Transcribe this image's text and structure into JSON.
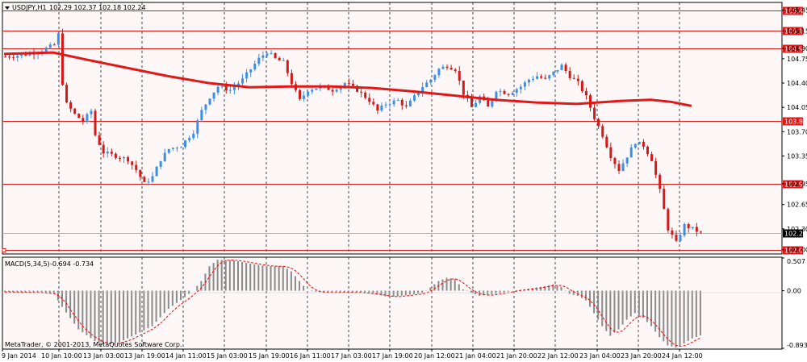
{
  "window": {
    "symbol_title": "USDJPY,H1",
    "ohlc_readout": "102.29 102.37 102.18 102.24",
    "dropdown_icon": "triangle-down-icon"
  },
  "indicator": {
    "title": "MACD(5,34,5)",
    "readout": "-0.694 -0.734"
  },
  "footer": {
    "copyright": "MetaTrader, © 2001-2013, MetaQuotes Software Corp."
  },
  "colors": {
    "background": "#fdf7f7",
    "bull_candle": "#3c8ee6",
    "bear_candle": "#d11a1a",
    "moving_average": "#e01818",
    "horizontal_line": "#e01818",
    "grid": "#000000",
    "macd_histogram": "#8a8a8a",
    "macd_signal": "#ff0000",
    "bid_line": "#b0b0b0"
  },
  "chart_data": [
    {
      "type": "candlestick",
      "title": "USDJPY,H1",
      "ylim": [
        101.95,
        105.55
      ],
      "y_ticks": [
        105.45,
        105.15,
        104.9,
        104.75,
        104.4,
        104.05,
        103.7,
        103.35,
        102.95,
        102.65,
        102.3,
        102.0
      ],
      "y_tick_labels": [
        "105.45",
        "105.15",
        "104.90",
        "104.75",
        "104.40",
        "104.05",
        "103.70",
        "103.35",
        "102.95",
        "102.65",
        "102.30",
        "102.00"
      ],
      "highlighted_levels": [
        "105.45",
        "105.15",
        "104.90",
        "103.85",
        "102.95",
        "102.00"
      ],
      "current_price": "102.24",
      "x_tick_labels": [
        "9 Jan 2014",
        "10 Jan 10:00",
        "13 Jan 03:00",
        "13 Jan 19:00",
        "14 Jan 11:00",
        "15 Jan 03:00",
        "15 Jan 19:00",
        "16 Jan 11:00",
        "17 Jan 03:00",
        "17 Jan 19:00",
        "20 Jan 12:00",
        "21 Jan 04:00",
        "21 Jan 20:00",
        "22 Jan 12:00",
        "23 Jan 04:00",
        "23 Jan 20:00",
        "24 Jan 12:00"
      ],
      "grid": true,
      "trend_path": [
        [
          0,
          104.78
        ],
        [
          4,
          104.8
        ],
        [
          8,
          104.85
        ],
        [
          10,
          104.9
        ],
        [
          12,
          104.95
        ],
        [
          13,
          105.1
        ],
        [
          14,
          104.4
        ],
        [
          15,
          104.1
        ],
        [
          17,
          103.95
        ],
        [
          19,
          103.85
        ],
        [
          21,
          104.0
        ],
        [
          22,
          103.65
        ],
        [
          24,
          103.4
        ],
        [
          27,
          103.35
        ],
        [
          30,
          103.3
        ],
        [
          32,
          103.15
        ],
        [
          34,
          102.95
        ],
        [
          36,
          103.05
        ],
        [
          38,
          103.3
        ],
        [
          40,
          103.45
        ],
        [
          43,
          103.5
        ],
        [
          46,
          103.7
        ],
        [
          48,
          104.0
        ],
        [
          50,
          104.2
        ],
        [
          52,
          104.35
        ],
        [
          55,
          104.3
        ],
        [
          58,
          104.45
        ],
        [
          60,
          104.6
        ],
        [
          62,
          104.75
        ],
        [
          64,
          104.85
        ],
        [
          66,
          104.75
        ],
        [
          68,
          104.7
        ],
        [
          70,
          104.4
        ],
        [
          72,
          104.15
        ],
        [
          74,
          104.3
        ],
        [
          77,
          104.35
        ],
        [
          80,
          104.3
        ],
        [
          83,
          104.4
        ],
        [
          86,
          104.3
        ],
        [
          89,
          104.15
        ],
        [
          91,
          104.0
        ],
        [
          93,
          104.1
        ],
        [
          96,
          104.15
        ],
        [
          98,
          104.05
        ],
        [
          100,
          104.2
        ],
        [
          102,
          104.35
        ],
        [
          104,
          104.45
        ],
        [
          106,
          104.6
        ],
        [
          108,
          104.65
        ],
        [
          110,
          104.6
        ],
        [
          112,
          104.25
        ],
        [
          114,
          104.05
        ],
        [
          116,
          104.2
        ],
        [
          118,
          104.05
        ],
        [
          120,
          104.3
        ],
        [
          123,
          104.25
        ],
        [
          126,
          104.35
        ],
        [
          128,
          104.45
        ],
        [
          130,
          104.5
        ],
        [
          132,
          104.45
        ],
        [
          134,
          104.55
        ],
        [
          136,
          104.65
        ],
        [
          138,
          104.5
        ],
        [
          140,
          104.4
        ],
        [
          142,
          104.2
        ],
        [
          144,
          103.9
        ],
        [
          146,
          103.65
        ],
        [
          148,
          103.35
        ],
        [
          150,
          103.15
        ],
        [
          152,
          103.35
        ],
        [
          154,
          103.55
        ],
        [
          156,
          103.5
        ],
        [
          158,
          103.3
        ],
        [
          160,
          102.85
        ],
        [
          162,
          102.3
        ],
        [
          164,
          102.1
        ],
        [
          166,
          102.35
        ],
        [
          168,
          102.3
        ],
        [
          170,
          102.24
        ]
      ],
      "moving_average": [
        [
          0,
          104.82
        ],
        [
          12,
          104.84
        ],
        [
          20,
          104.74
        ],
        [
          30,
          104.62
        ],
        [
          40,
          104.5
        ],
        [
          50,
          104.4
        ],
        [
          60,
          104.34
        ],
        [
          70,
          104.35
        ],
        [
          80,
          104.35
        ],
        [
          90,
          104.33
        ],
        [
          100,
          104.28
        ],
        [
          110,
          104.22
        ],
        [
          120,
          104.16
        ],
        [
          130,
          104.12
        ],
        [
          140,
          104.1
        ],
        [
          150,
          104.14
        ],
        [
          158,
          104.16
        ],
        [
          163,
          104.13
        ],
        [
          168,
          104.07
        ]
      ]
    },
    {
      "type": "histogram",
      "title": "MACD(5,34,5)",
      "ylim": [
        -0.893,
        0.507
      ],
      "y_ticks": [
        0.507,
        0.0,
        -0.893
      ],
      "y_tick_labels": [
        "0.507",
        "0.00",
        "-0.893"
      ],
      "macd_path": [
        [
          0,
          -0.02
        ],
        [
          8,
          -0.03
        ],
        [
          12,
          -0.05
        ],
        [
          14,
          -0.25
        ],
        [
          18,
          -0.6
        ],
        [
          22,
          -0.78
        ],
        [
          24,
          -0.83
        ],
        [
          28,
          -0.8
        ],
        [
          32,
          -0.68
        ],
        [
          36,
          -0.55
        ],
        [
          40,
          -0.28
        ],
        [
          44,
          -0.1
        ],
        [
          46,
          0.0
        ],
        [
          48,
          0.15
        ],
        [
          50,
          0.38
        ],
        [
          52,
          0.48
        ],
        [
          56,
          0.47
        ],
        [
          60,
          0.42
        ],
        [
          64,
          0.38
        ],
        [
          68,
          0.38
        ],
        [
          70,
          0.3
        ],
        [
          74,
          0.0
        ],
        [
          78,
          -0.03
        ],
        [
          82,
          -0.02
        ],
        [
          86,
          -0.03
        ],
        [
          90,
          -0.05
        ],
        [
          94,
          -0.1
        ],
        [
          98,
          -0.07
        ],
        [
          102,
          -0.04
        ],
        [
          104,
          0.05
        ],
        [
          106,
          0.15
        ],
        [
          108,
          0.2
        ],
        [
          110,
          0.18
        ],
        [
          112,
          0.02
        ],
        [
          116,
          -0.08
        ],
        [
          120,
          -0.05
        ],
        [
          124,
          0.0
        ],
        [
          128,
          0.03
        ],
        [
          132,
          0.07
        ],
        [
          134,
          0.1
        ],
        [
          136,
          0.06
        ],
        [
          138,
          -0.05
        ],
        [
          140,
          -0.08
        ],
        [
          142,
          -0.15
        ],
        [
          144,
          -0.35
        ],
        [
          146,
          -0.55
        ],
        [
          148,
          -0.7
        ],
        [
          150,
          -0.6
        ],
        [
          152,
          -0.45
        ],
        [
          154,
          -0.35
        ],
        [
          156,
          -0.42
        ],
        [
          158,
          -0.55
        ],
        [
          160,
          -0.72
        ],
        [
          162,
          -0.85
        ],
        [
          164,
          -0.88
        ],
        [
          166,
          -0.82
        ],
        [
          168,
          -0.74
        ],
        [
          170,
          -0.694
        ]
      ],
      "signal_lag": 3
    }
  ]
}
